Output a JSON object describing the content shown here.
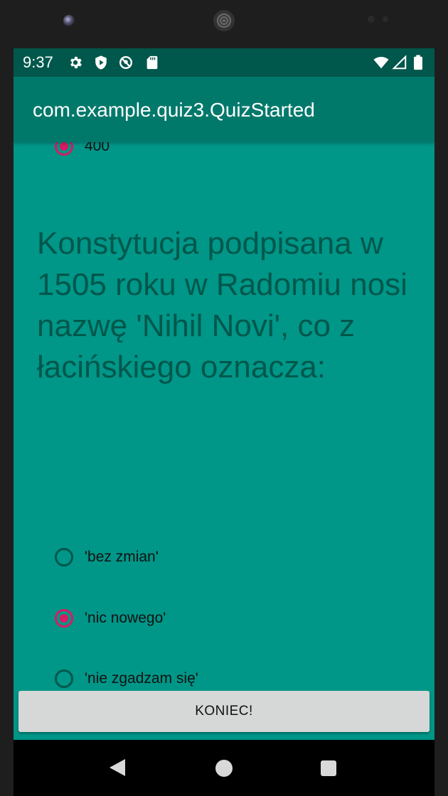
{
  "status_bar": {
    "time": "9:37",
    "icons": [
      "settings-gear-icon",
      "shield-play-icon",
      "location-off-icon",
      "sd-card-icon",
      "wifi-icon",
      "signal-icon",
      "battery-icon"
    ]
  },
  "app_bar": {
    "title": "com.example.quiz3.QuizStarted"
  },
  "previous_question": {
    "selected_answer": "400"
  },
  "question": {
    "text": "Konstytucja podpisana w 1505 roku w Radomiu nosi nazwę 'Nihil Novi', co z łacińskiego oznacza:",
    "options": [
      {
        "label": "'bez zmian'",
        "checked": false
      },
      {
        "label": "'nic nowego'",
        "checked": true
      },
      {
        "label": "'nie zgadzam się'",
        "checked": false
      }
    ]
  },
  "finish_button": {
    "label": "KONIEC!"
  },
  "colors": {
    "primary": "#009688",
    "primary_dark": "#00574b",
    "app_bar": "#00796b",
    "accent": "#d81b60",
    "button": "#d6d7d7"
  },
  "nav_bar": {
    "icons": [
      "back-icon",
      "home-icon",
      "recents-icon"
    ]
  }
}
